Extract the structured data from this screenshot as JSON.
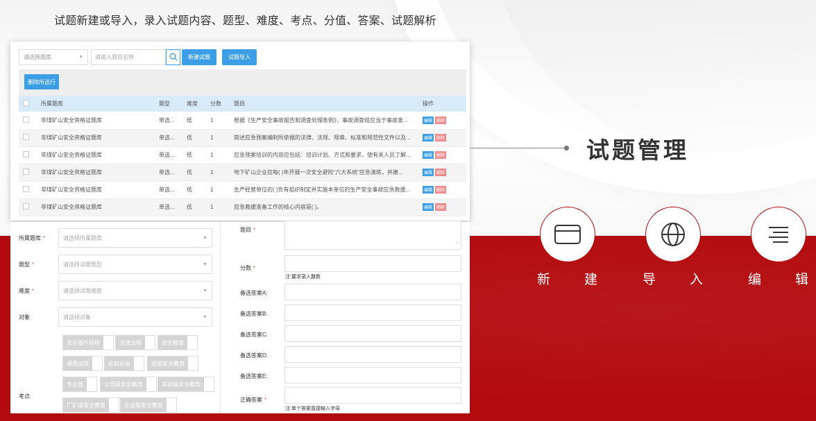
{
  "header": {
    "description": "试题新建或导入，录入试题内容、题型、难度、考点、分值、答案、试题解析"
  },
  "section": {
    "title": "试题管理"
  },
  "features": [
    {
      "icon": "card-icon",
      "label_a": "新",
      "label_b": "建"
    },
    {
      "icon": "globe-icon",
      "label_a": "导",
      "label_b": "入"
    },
    {
      "icon": "menu-lines-icon",
      "label_a": "编",
      "label_b": "辑"
    }
  ],
  "list": {
    "bank_select_placeholder": "请选择题库",
    "search_placeholder": "请输入题目名称",
    "new_button": "新建试题",
    "import_button": "试题导入",
    "delete_selected_button": "删除所选行",
    "columns": [
      "所属题库",
      "题型",
      "难度",
      "分数",
      "题目",
      "操作"
    ],
    "rows": [
      {
        "bank": "非煤矿山安全资格证题库",
        "type": "单选...",
        "difficulty": "低",
        "score": "1",
        "question": "根据《生产安全事故报告和调查处理条例》，事故调查组应当于事故发..."
      },
      {
        "bank": "非煤矿山安全资格证题库",
        "type": "单选...",
        "difficulty": "低",
        "score": "1",
        "question": "简述应急预案编制所依据的法律、法规、规章、标准和规范性文件以及..."
      },
      {
        "bank": "非煤矿山安全资格证题库",
        "type": "单选...",
        "difficulty": "低",
        "score": "1",
        "question": "应急预案培训的内容应包括：培训计划、方式和要求，使有关人员了解..."
      },
      {
        "bank": "非煤矿山安全资格证题库",
        "type": "单选...",
        "difficulty": "低",
        "score": "1",
        "question": "地下矿山企业应每( )年开展一次安全避险“六大系统”应急演练，并建..."
      },
      {
        "bank": "非煤矿山安全资格证题库",
        "type": "单选...",
        "difficulty": "低",
        "score": "1",
        "question": "生产经营单位的( )负有组织制定并实施本单位的生产安全事故应急救援..."
      },
      {
        "bank": "非煤矿山安全资格证题库",
        "type": "单选...",
        "difficulty": "低",
        "score": "1",
        "question": "应急救援准备工作的核心内容是( )。"
      }
    ],
    "edit_label": "编辑",
    "delete_label": "删除"
  },
  "form": {
    "bank_label": "所属题库",
    "bank_placeholder": "请选择所属题库",
    "type_label": "题型",
    "type_placeholder": "请选择试题题型",
    "difficulty_label": "难度",
    "difficulty_placeholder": "请选择试题难度",
    "target_label": "对象",
    "target_placeholder": "请选择对象",
    "point_label": "考点",
    "tags": [
      "安全操作规程",
      "法律法规",
      "安全教育",
      "通用试题",
      "必知必会",
      "班组安全教育",
      "专业题",
      "公司级安全教育",
      "车间级安全教育",
      "厂矿级安全教育",
      "企业级安全教育"
    ],
    "question_label": "题目",
    "score_label": "分数",
    "score_note": "注:要求录入整数",
    "option_a_label": "备选答案A:",
    "option_b_label": "备选答案B:",
    "option_c_label": "备选答案C:",
    "option_d_label": "备选答案D:",
    "option_e_label": "备选答案E:",
    "answer_label": "正确答案",
    "answer_note": "注:单个答案直接输入字母",
    "required_mark": "*"
  }
}
